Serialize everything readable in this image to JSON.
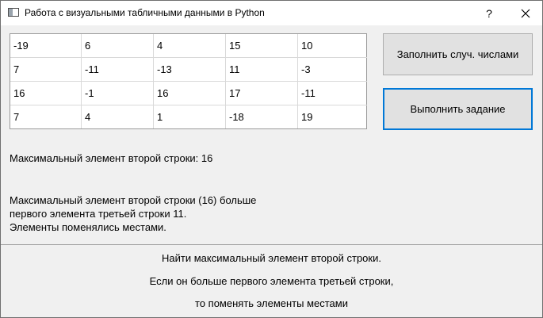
{
  "window": {
    "title": "Работа с визуальными табличными данными в Python",
    "help_label": "?"
  },
  "table": {
    "rows": [
      [
        "-19",
        "6",
        "4",
        "15",
        "10"
      ],
      [
        "7",
        "-11",
        "-13",
        "11",
        "-3"
      ],
      [
        "16",
        "-1",
        "16",
        "17",
        "-11"
      ],
      [
        "7",
        "4",
        "1",
        "-18",
        "19"
      ]
    ]
  },
  "buttons": {
    "fill_label": "Заполнить случ. числами",
    "run_label": "Выполнить задание"
  },
  "results": {
    "max_label": "Максимальный элемент второй строки: 16",
    "lines": [
      "Максимальный элемент второй строки (16) больше",
      "первого элемента третьей строки 11.",
      "Элементы поменялись местами."
    ]
  },
  "task": {
    "lines": [
      "Найти максимальный элемент второй строки.",
      "Если он больше первого элемента третьей строки,",
      "то поменять элементы местами"
    ]
  },
  "icons": {
    "app": "app-window-icon",
    "close": "close-icon"
  }
}
